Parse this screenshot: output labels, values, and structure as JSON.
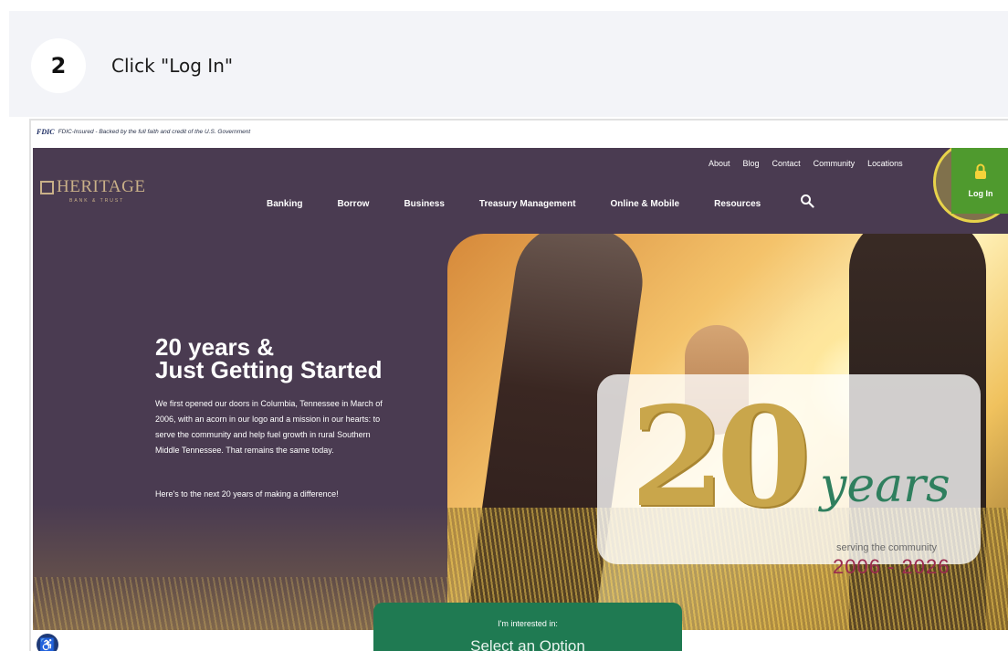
{
  "guide": {
    "step_number": "2",
    "step_text": "Click \"Log In\""
  },
  "fdic_bar": {
    "logo": "FDIC",
    "text": "FDIC-Insured - Backed by the full faith and credit of the U.S. Government"
  },
  "site": {
    "logo_name": "HERITAGE",
    "logo_sub": "BANK & TRUST",
    "utility_nav": [
      "About",
      "Blog",
      "Contact",
      "Community",
      "Locations"
    ],
    "main_nav": [
      "Banking",
      "Borrow",
      "Business",
      "Treasury Management",
      "Online & Mobile",
      "Resources"
    ],
    "login_label": "Log In",
    "colors": {
      "nav_bg": "#4a3b51",
      "login_bg": "#4f9a2e",
      "highlight": "#e7d34a",
      "interest_bg": "#1f7a52"
    }
  },
  "hero": {
    "title_line1": "20 years &",
    "title_line2": "Just Getting Started",
    "body": "We first opened our doors in Columbia, Tennessee in March of 2006, with an acorn in our logo and a mission in our hearts: to serve the community and help fuel growth in rural Southern Middle Tennessee. That remains the same today.",
    "cta": "Here's to the next 20 years of making a difference!"
  },
  "badge": {
    "number": "20",
    "word": "years",
    "serving": "serving the community",
    "range": "2006 - 2026"
  },
  "interest": {
    "label": "I'm interested in:",
    "select": "Select an Option"
  }
}
